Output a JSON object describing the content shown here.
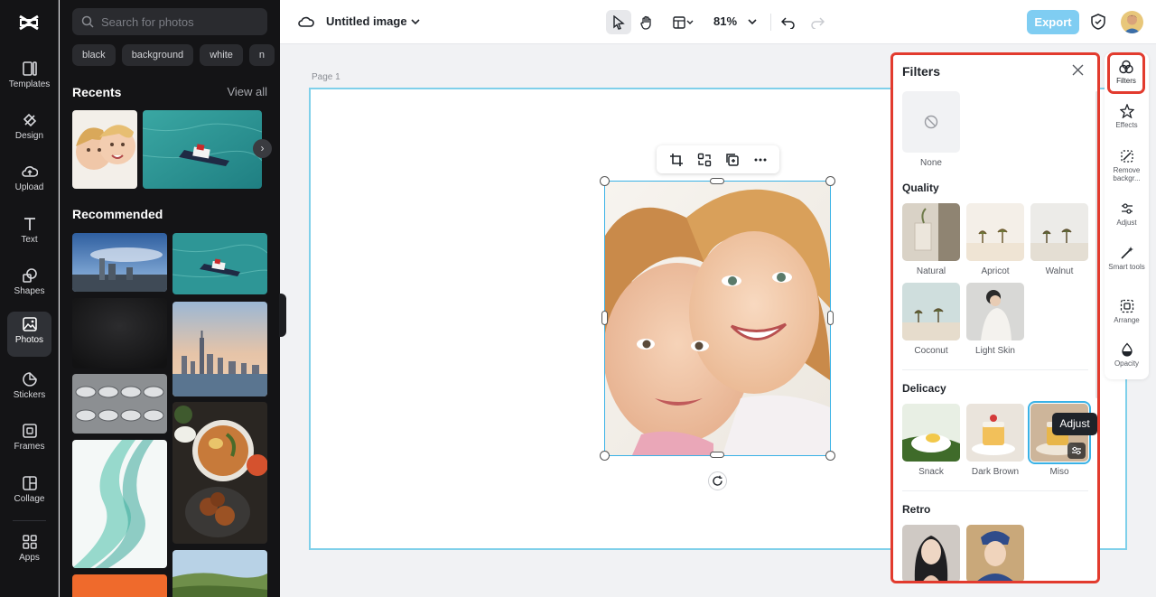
{
  "colors": {
    "accent": "#3ab2e6",
    "highlight": "#e23b2e",
    "export": "#7fcdf2",
    "rail_bg": "#141416"
  },
  "sidebar": {
    "items": [
      {
        "label": "Templates",
        "icon": "templates-icon"
      },
      {
        "label": "Design",
        "icon": "design-icon"
      },
      {
        "label": "Upload",
        "icon": "upload-icon"
      },
      {
        "label": "Text",
        "icon": "text-icon"
      },
      {
        "label": "Shapes",
        "icon": "shapes-icon"
      },
      {
        "label": "Photos",
        "icon": "photos-icon",
        "active": true
      },
      {
        "label": "Stickers",
        "icon": "stickers-icon"
      },
      {
        "label": "Frames",
        "icon": "frames-icon"
      },
      {
        "label": "Collage",
        "icon": "collage-icon"
      },
      {
        "label": "Apps",
        "icon": "apps-icon"
      }
    ]
  },
  "photos_panel": {
    "search_placeholder": "Search for photos",
    "chips": [
      "black",
      "background",
      "white",
      "n"
    ],
    "recents_title": "Recents",
    "view_all": "View all",
    "recommended_title": "Recommended"
  },
  "topbar": {
    "title": "Untitled image",
    "zoom": "81%",
    "export": "Export"
  },
  "canvas": {
    "page_label": "Page 1"
  },
  "filters": {
    "title": "Filters",
    "none_label": "None",
    "sections": [
      {
        "title": "Quality",
        "items": [
          "Natural",
          "Apricot",
          "Walnut",
          "Coconut",
          "Light Skin"
        ]
      },
      {
        "title": "Delicacy",
        "items": [
          "Snack",
          "Dark Brown",
          "Miso"
        ],
        "selected": "Miso"
      },
      {
        "title": "Retro",
        "items": [
          "",
          ""
        ]
      }
    ],
    "tooltip": "Adjust"
  },
  "properties": {
    "items": [
      {
        "label": "Filters",
        "icon": "filters-icon",
        "active": true
      },
      {
        "label": "Effects",
        "icon": "effects-icon"
      },
      {
        "label": "Remove backgr...",
        "icon": "remove-background-icon"
      },
      {
        "label": "Adjust",
        "icon": "adjust-icon"
      },
      {
        "label": "Smart tools",
        "icon": "smart-tools-icon"
      },
      {
        "label": "Arrange",
        "icon": "arrange-icon"
      },
      {
        "label": "Opacity",
        "icon": "opacity-icon"
      }
    ]
  }
}
